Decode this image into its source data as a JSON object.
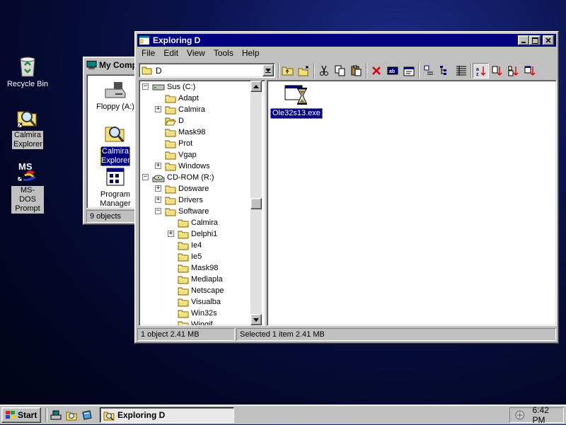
{
  "desktop": {
    "icons": [
      {
        "label": "Recycle Bin"
      },
      {
        "label": "Calmira Explorer"
      },
      {
        "label": "MS-DOS Prompt"
      }
    ]
  },
  "my_computer": {
    "title": "My Comp",
    "items": [
      "Floppy (A:)",
      "Calmira Explorer",
      "Program Manager"
    ],
    "status": "9 objects"
  },
  "explorer": {
    "title": "Exploring D",
    "menu": [
      "File",
      "Edit",
      "View",
      "Tools",
      "Help"
    ],
    "combo_value": "D",
    "tree": [
      {
        "label": "Sus (C:)",
        "level": 0,
        "toggle": "-",
        "icon": "drive-icon"
      },
      {
        "label": "Adapt",
        "level": 1,
        "toggle": "",
        "icon": "folder-icon"
      },
      {
        "label": "Calmira",
        "level": 1,
        "toggle": "+",
        "icon": "folder-icon"
      },
      {
        "label": "D",
        "level": 1,
        "toggle": "",
        "icon": "folder-open-icon"
      },
      {
        "label": "Mask98",
        "level": 1,
        "toggle": "",
        "icon": "folder-icon"
      },
      {
        "label": "Prot",
        "level": 1,
        "toggle": "",
        "icon": "folder-icon"
      },
      {
        "label": "Vgap",
        "level": 1,
        "toggle": "",
        "icon": "folder-icon"
      },
      {
        "label": "Windows",
        "level": 1,
        "toggle": "+",
        "icon": "folder-icon"
      },
      {
        "label": "CD-ROM (R:)",
        "level": 0,
        "toggle": "-",
        "icon": "cdrom-icon"
      },
      {
        "label": "Dosware",
        "level": 1,
        "toggle": "+",
        "icon": "folder-icon"
      },
      {
        "label": "Drivers",
        "level": 1,
        "toggle": "+",
        "icon": "folder-icon"
      },
      {
        "label": "Software",
        "level": 1,
        "toggle": "-",
        "icon": "folder-icon"
      },
      {
        "label": "Calmira",
        "level": 2,
        "toggle": "",
        "icon": "folder-icon"
      },
      {
        "label": "Delphi1",
        "level": 2,
        "toggle": "+",
        "icon": "folder-icon"
      },
      {
        "label": "Ie4",
        "level": 2,
        "toggle": "",
        "icon": "folder-icon"
      },
      {
        "label": "Ie5",
        "level": 2,
        "toggle": "",
        "icon": "folder-icon"
      },
      {
        "label": "Mask98",
        "level": 2,
        "toggle": "",
        "icon": "folder-icon"
      },
      {
        "label": "Mediapla",
        "level": 2,
        "toggle": "",
        "icon": "folder-icon"
      },
      {
        "label": "Netscape",
        "level": 2,
        "toggle": "",
        "icon": "folder-icon"
      },
      {
        "label": "Visualba",
        "level": 2,
        "toggle": "",
        "icon": "folder-icon"
      },
      {
        "label": "Win32s",
        "level": 2,
        "toggle": "",
        "icon": "folder-icon"
      },
      {
        "label": "Wingif",
        "level": 2,
        "toggle": "",
        "icon": "folder-icon"
      }
    ],
    "files": [
      {
        "name": "Ole32s13.exe",
        "selected": true
      }
    ],
    "status_left": "1 object  2.41 MB",
    "status_right": "Selected 1 item  2.41 MB"
  },
  "taskbar": {
    "start_label": "Start",
    "task_label": "Exploring D",
    "clock": "6:42 PM"
  }
}
